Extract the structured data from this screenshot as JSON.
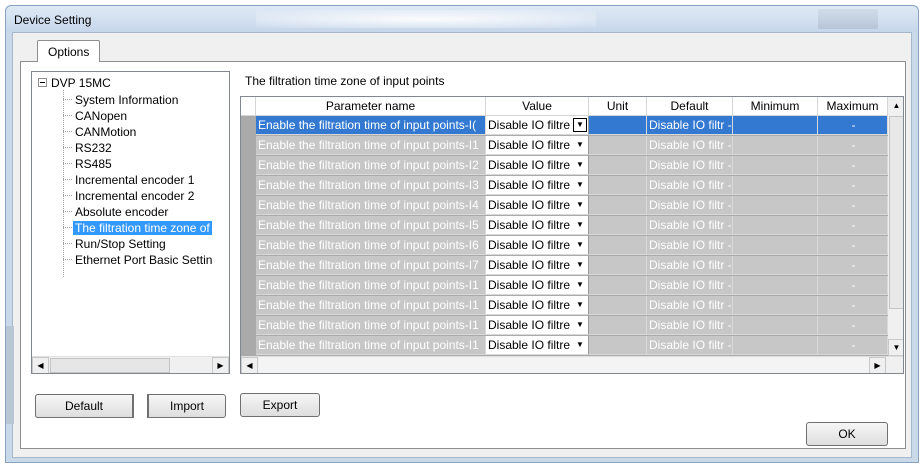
{
  "window": {
    "title": "Device Setting"
  },
  "tab": {
    "label": "Options"
  },
  "tree": {
    "root": "DVP 15MC",
    "items": [
      {
        "label": "System Information",
        "selected": false
      },
      {
        "label": "CANopen",
        "selected": false
      },
      {
        "label": "CANMotion",
        "selected": false
      },
      {
        "label": "RS232",
        "selected": false
      },
      {
        "label": "RS485",
        "selected": false
      },
      {
        "label": "Incremental encoder 1",
        "selected": false
      },
      {
        "label": "Incremental encoder 2",
        "selected": false
      },
      {
        "label": "Absolute encoder",
        "selected": false
      },
      {
        "label": "The filtration time zone of",
        "selected": true
      },
      {
        "label": "Run/Stop Setting",
        "selected": false
      },
      {
        "label": "Ethernet Port Basic Settin",
        "selected": false
      }
    ]
  },
  "section_title": "The filtration time zone of input points",
  "grid": {
    "headers": [
      "Parameter name",
      "Value",
      "Unit",
      "Default",
      "Minimum",
      "Maximum"
    ],
    "rows": [
      {
        "name": "Enable the filtration time of input points-I(",
        "value": "Disable IO filtre",
        "unit": "",
        "default": "Disable IO filtr -",
        "min": "",
        "max": "-",
        "selected": true
      },
      {
        "name": "Enable the filtration time of input points-I1",
        "value": "Disable IO filtre",
        "unit": "",
        "default": "Disable IO filtr -",
        "min": "",
        "max": "-",
        "selected": false
      },
      {
        "name": "Enable the filtration time of input points-I2",
        "value": "Disable IO filtre",
        "unit": "",
        "default": "Disable IO filtr -",
        "min": "",
        "max": "-",
        "selected": false
      },
      {
        "name": "Enable the filtration time of input points-I3",
        "value": "Disable IO filtre",
        "unit": "",
        "default": "Disable IO filtr -",
        "min": "",
        "max": "-",
        "selected": false
      },
      {
        "name": "Enable the filtration time of input points-I4",
        "value": "Disable IO filtre",
        "unit": "",
        "default": "Disable IO filtr -",
        "min": "",
        "max": "-",
        "selected": false
      },
      {
        "name": "Enable the filtration time of input points-I5",
        "value": "Disable IO filtre",
        "unit": "",
        "default": "Disable IO filtr -",
        "min": "",
        "max": "-",
        "selected": false
      },
      {
        "name": "Enable the filtration time of input points-I6",
        "value": "Disable IO filtre",
        "unit": "",
        "default": "Disable IO filtr -",
        "min": "",
        "max": "-",
        "selected": false
      },
      {
        "name": "Enable the filtration time of input points-I7",
        "value": "Disable IO filtre",
        "unit": "",
        "default": "Disable IO filtr -",
        "min": "",
        "max": "-",
        "selected": false
      },
      {
        "name": "Enable the filtration time of input points-I1",
        "value": "Disable IO filtre",
        "unit": "",
        "default": "Disable IO filtr -",
        "min": "",
        "max": "-",
        "selected": false
      },
      {
        "name": "Enable the filtration time of input points-I1",
        "value": "Disable IO filtre",
        "unit": "",
        "default": "Disable IO filtr -",
        "min": "",
        "max": "-",
        "selected": false
      },
      {
        "name": "Enable the filtration time of input points-I1",
        "value": "Disable IO filtre",
        "unit": "",
        "default": "Disable IO filtr -",
        "min": "",
        "max": "-",
        "selected": false
      },
      {
        "name": "Enable the filtration time of input points-I1",
        "value": "Disable IO filtre",
        "unit": "",
        "default": "Disable IO filtr -",
        "min": "",
        "max": "-",
        "selected": false
      }
    ]
  },
  "buttons": {
    "default": "Default",
    "import": "Import",
    "export": "Export",
    "ok": "OK"
  },
  "icons": {
    "dropdown": "chevron-down-icon",
    "collapse": "minus-box-icon",
    "scroll_left": "arrow-left-icon",
    "scroll_right": "arrow-right-icon",
    "scroll_up": "arrow-up-icon",
    "scroll_down": "arrow-down-icon"
  },
  "colors": {
    "selection": "#3399ff",
    "grid_selected_row": "#3379d2",
    "grid_cell": "#c7c7c7",
    "grid_bg": "#aaaaaa"
  }
}
